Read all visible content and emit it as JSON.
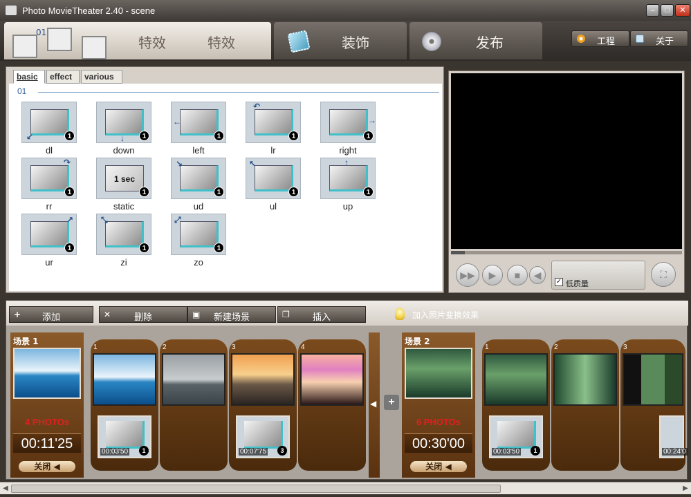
{
  "window": {
    "title": "Photo MovieTheater 2.40 - scene",
    "min": "–",
    "max": "□",
    "close": "✕"
  },
  "tabs": [
    {
      "label": "特效",
      "num": "01"
    },
    {
      "label": "装饰"
    },
    {
      "label": "发布"
    }
  ],
  "toolbar": {
    "project": "工程",
    "about": "关于"
  },
  "effects": {
    "subtabs": [
      "basic",
      "effect",
      "various"
    ],
    "section": "01",
    "items": [
      {
        "name": "dl",
        "badge": "1",
        "arrow": "↙"
      },
      {
        "name": "down",
        "badge": "1",
        "arrow": "↓"
      },
      {
        "name": "left",
        "badge": "1",
        "arrow": "←"
      },
      {
        "name": "lr",
        "badge": "1",
        "arrow": "↶"
      },
      {
        "name": "right",
        "badge": "1",
        "arrow": "→"
      },
      {
        "name": "rr",
        "badge": "1",
        "arrow": "↷"
      },
      {
        "name": "static",
        "badge": "1",
        "text": "1 sec"
      },
      {
        "name": "ud",
        "badge": "1",
        "arrow": "↘"
      },
      {
        "name": "ul",
        "badge": "1",
        "arrow": "↖"
      },
      {
        "name": "up",
        "badge": "1",
        "arrow": "↑"
      },
      {
        "name": "ur",
        "badge": "1",
        "arrow": "↗"
      },
      {
        "name": "zi",
        "badge": "1",
        "arrow": "⤡"
      },
      {
        "name": "zo",
        "badge": "1",
        "arrow": "⤢"
      }
    ]
  },
  "preview": {
    "quality_label": "低质量",
    "quality_checked": "✓",
    "progress": 0.06
  },
  "storyboard": {
    "add": "添加",
    "delete": "删除",
    "new_scene": "新建场景",
    "insert": "插入",
    "hint": "加入照片变换效果",
    "scenes": [
      {
        "label": "场景 1",
        "photos": "4 PHOTOs",
        "duration": "00:11'25",
        "close": "关闭 ◀",
        "slides": [
          {
            "num": "1",
            "time": "00:03'50",
            "badge": "1"
          },
          {
            "num": "2"
          },
          {
            "num": "3",
            "time": "00:07'75",
            "badge": "3"
          },
          {
            "num": "4"
          }
        ]
      },
      {
        "label": "场景 2",
        "photos": "6 PHOTOs",
        "duration": "00:30'00",
        "close": "关闭 ◀",
        "slides": [
          {
            "num": "1",
            "time": "00:03'50",
            "badge": "1"
          },
          {
            "num": "2"
          },
          {
            "num": "3",
            "time": "00:24'0"
          }
        ]
      }
    ]
  }
}
